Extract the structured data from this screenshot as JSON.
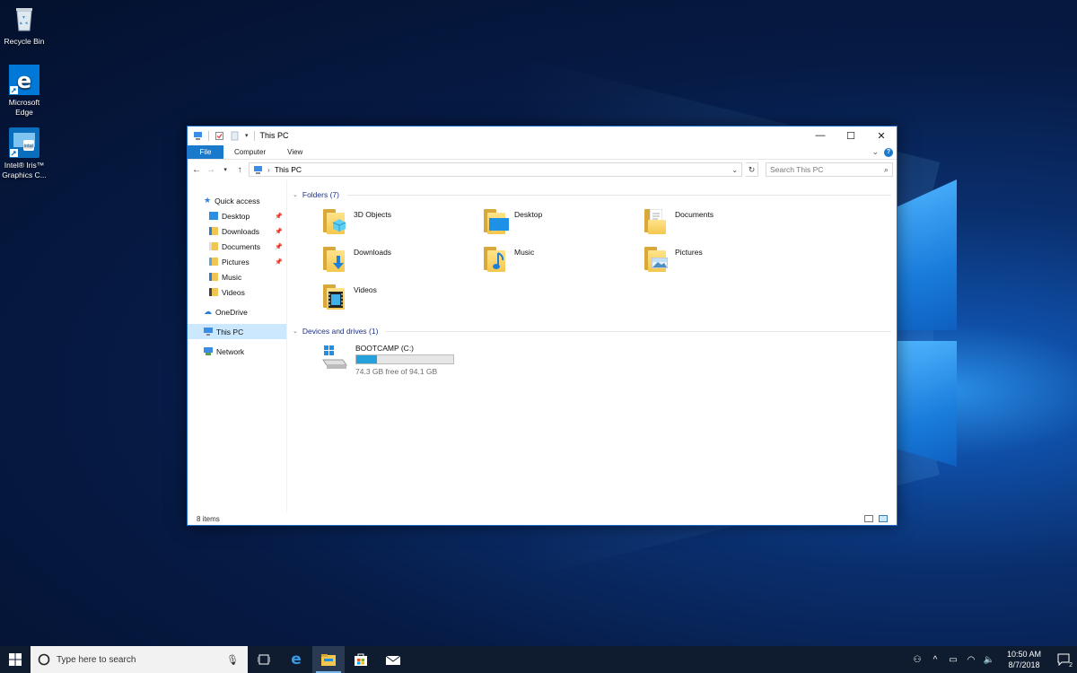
{
  "desktop": {
    "icons": [
      {
        "label": "Recycle Bin",
        "icon": "recycle-bin-icon"
      },
      {
        "label": "Microsoft Edge",
        "icon": "edge-icon"
      },
      {
        "label": "Intel® Iris™ Graphics C...",
        "icon": "intel-graphics-icon"
      }
    ]
  },
  "window": {
    "title": "This PC",
    "controls": {
      "minimize": "—",
      "maximize": "☐",
      "close": "✕"
    },
    "ribbon": {
      "file_label": "File",
      "tabs": [
        "Computer",
        "View"
      ]
    },
    "address": {
      "path": "This PC",
      "search_placeholder": "Search This PC"
    },
    "nav_pane": {
      "quick_access": "Quick access",
      "quick_items": [
        {
          "label": "Desktop",
          "pinned": true
        },
        {
          "label": "Downloads",
          "pinned": true
        },
        {
          "label": "Documents",
          "pinned": true
        },
        {
          "label": "Pictures",
          "pinned": true
        },
        {
          "label": "Music",
          "pinned": false
        },
        {
          "label": "Videos",
          "pinned": false
        }
      ],
      "onedrive": "OneDrive",
      "this_pc": "This PC",
      "network": "Network"
    },
    "folders_header": "Folders (7)",
    "folders": [
      {
        "label": "3D Objects",
        "overlay": "cube"
      },
      {
        "label": "Desktop",
        "overlay": "desktop"
      },
      {
        "label": "Documents",
        "overlay": "document"
      },
      {
        "label": "Downloads",
        "overlay": "download-arrow"
      },
      {
        "label": "Music",
        "overlay": "music-note"
      },
      {
        "label": "Pictures",
        "overlay": "picture"
      },
      {
        "label": "Videos",
        "overlay": "film"
      }
    ],
    "devices_header": "Devices and drives (1)",
    "drive": {
      "name": "BOOTCAMP (C:)",
      "free_text": "74.3 GB free of 94.1 GB",
      "used_fraction": 0.21
    },
    "status": "8 items"
  },
  "taskbar": {
    "search_placeholder": "Type here to search",
    "time": "10:50 AM",
    "date": "8/7/2018",
    "notification_count": "2",
    "accent_color": "#76b9ed"
  }
}
